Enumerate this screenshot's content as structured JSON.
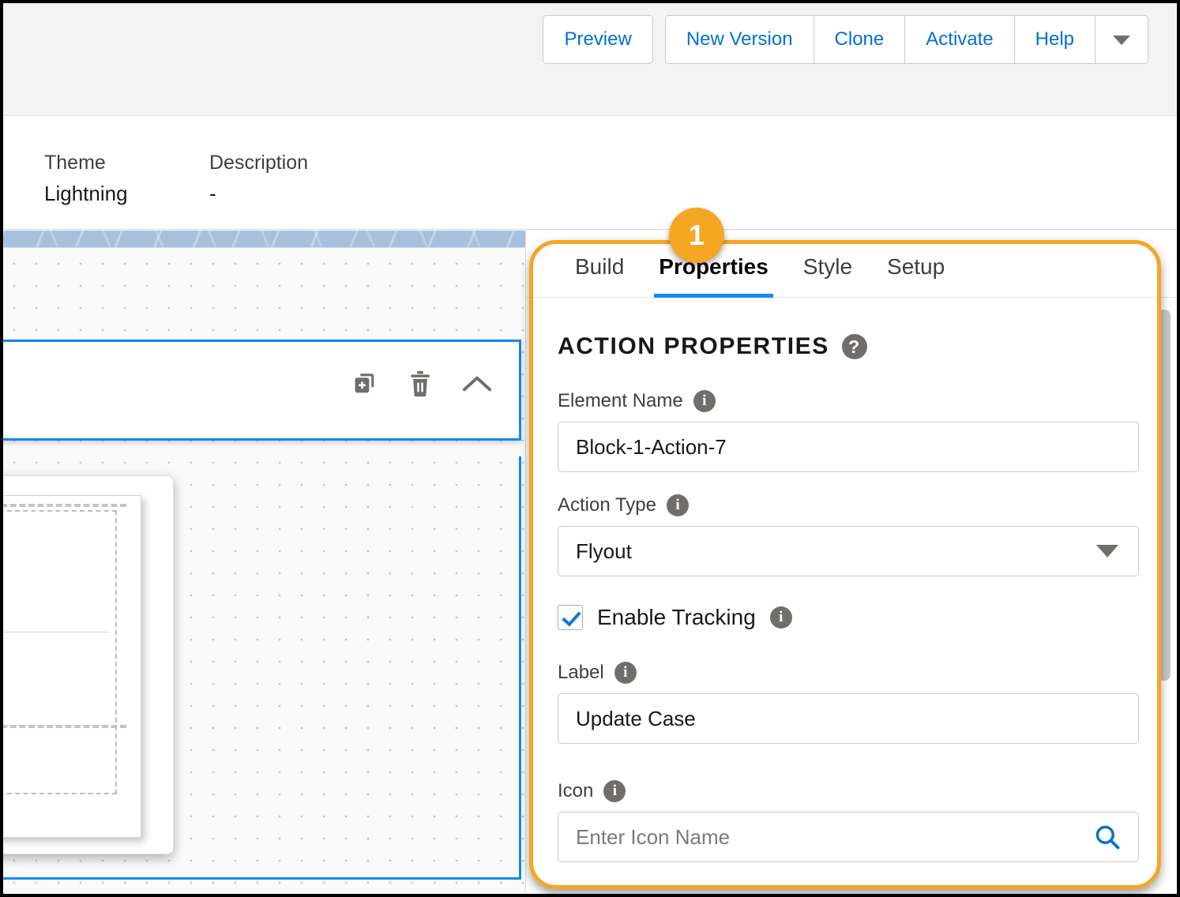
{
  "toolbar": {
    "preview_label": "Preview",
    "new_version_label": "New Version",
    "clone_label": "Clone",
    "activate_label": "Activate",
    "help_label": "Help",
    "more_icon": "chevron-down-icon"
  },
  "meta": {
    "theme_label": "Theme",
    "theme_value": "Lightning",
    "description_label": "Description",
    "description_value": "-"
  },
  "canvas": {
    "duplicate_icon": "duplicate-icon",
    "delete_icon": "trash-icon",
    "collapse_icon": "chevron-up-icon"
  },
  "panel": {
    "tabs": [
      {
        "label": "Build",
        "active": false
      },
      {
        "label": "Properties",
        "active": true
      },
      {
        "label": "Style",
        "active": false
      },
      {
        "label": "Setup",
        "active": false
      }
    ],
    "section_title": "ACTION PROPERTIES",
    "section_help_icon": "help-circle-icon",
    "fields": {
      "element_name": {
        "label": "Element Name",
        "info_icon": "info-circle-icon",
        "value": "Block-1-Action-7",
        "placeholder": ""
      },
      "action_type": {
        "label": "Action Type",
        "info_icon": "info-circle-icon",
        "value": "Flyout",
        "dropdown_icon": "chevron-down-icon"
      },
      "enable_tracking": {
        "label": "Enable Tracking",
        "info_icon": "info-circle-icon",
        "checked": true
      },
      "label_field": {
        "label": "Label",
        "info_icon": "info-circle-icon",
        "value": "Update Case",
        "placeholder": ""
      },
      "icon_field": {
        "label": "Icon",
        "info_icon": "info-circle-icon",
        "value": "",
        "placeholder": "Enter Icon Name",
        "search_icon": "search-icon"
      }
    }
  },
  "callout": {
    "step_number": "1",
    "accent_color": "#f5a623"
  },
  "colors": {
    "link_blue": "#0070d2",
    "selection_blue": "#1589ee",
    "banner_blue": "#a9c0dd",
    "info_gray": "#706e6b"
  }
}
